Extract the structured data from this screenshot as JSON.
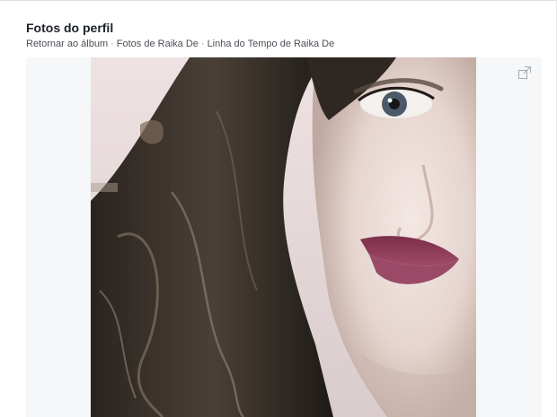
{
  "header": {
    "title": "Fotos do perfil"
  },
  "breadcrumb": {
    "items": [
      {
        "label": "Retornar ao álbum"
      },
      {
        "label": "Fotos de Raika De"
      },
      {
        "label": "Linha do Tempo de Raika De"
      }
    ],
    "separator": "·"
  },
  "viewer": {
    "photo_subject": "profile-photo-selfie",
    "expand_icon": "expand-icon",
    "stage_background": "#f6f7f9"
  }
}
